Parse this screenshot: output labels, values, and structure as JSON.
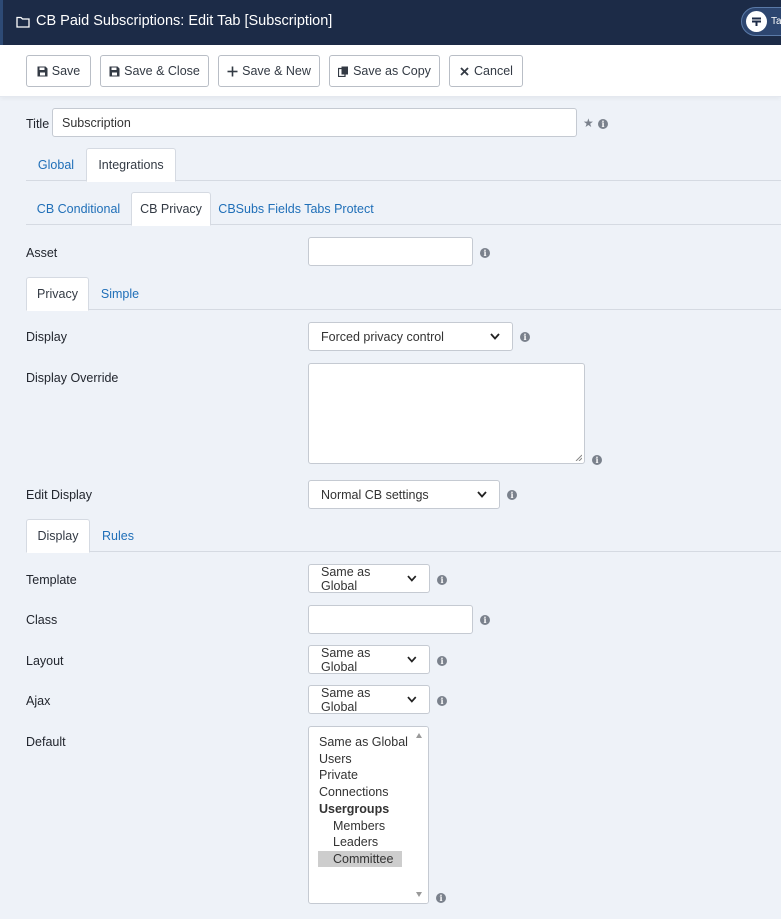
{
  "header": {
    "title": "CB Paid Subscriptions: Edit Tab [Subscription]",
    "pill_text": "Tal"
  },
  "toolbar": {
    "save": "Save",
    "save_close": "Save & Close",
    "save_new": "Save & New",
    "save_copy": "Save as Copy",
    "cancel": "Cancel"
  },
  "title_field": {
    "label": "Title",
    "value": "Subscription"
  },
  "tabs_main": [
    "Global",
    "Integrations"
  ],
  "tabs_integrations": [
    "CB Conditional",
    "CB Privacy",
    "CBSubs Fields Tabs Protect"
  ],
  "asset": {
    "label": "Asset",
    "value": ""
  },
  "tabs_privacy": [
    "Privacy",
    "Simple"
  ],
  "display": {
    "label": "Display",
    "value": "Forced privacy control"
  },
  "display_override": {
    "label": "Display Override"
  },
  "edit_display": {
    "label": "Edit Display",
    "value": "Normal CB settings"
  },
  "tabs_display": [
    "Display",
    "Rules"
  ],
  "template": {
    "label": "Template",
    "value": "Same as Global"
  },
  "class_field": {
    "label": "Class",
    "value": ""
  },
  "layout": {
    "label": "Layout",
    "value": "Same as Global"
  },
  "ajax": {
    "label": "Ajax",
    "value": "Same as Global"
  },
  "default_field": {
    "label": "Default",
    "options": [
      "Same as Global",
      "Users",
      "Private",
      "Connections"
    ],
    "group": "Usergroups",
    "group_options": [
      "Members",
      "Leaders",
      "Committee"
    ],
    "selected": "Committee"
  },
  "colors": {
    "header_bg": "#1c2b47",
    "link": "#1f6fb8",
    "page_bg": "#eef2f8"
  }
}
